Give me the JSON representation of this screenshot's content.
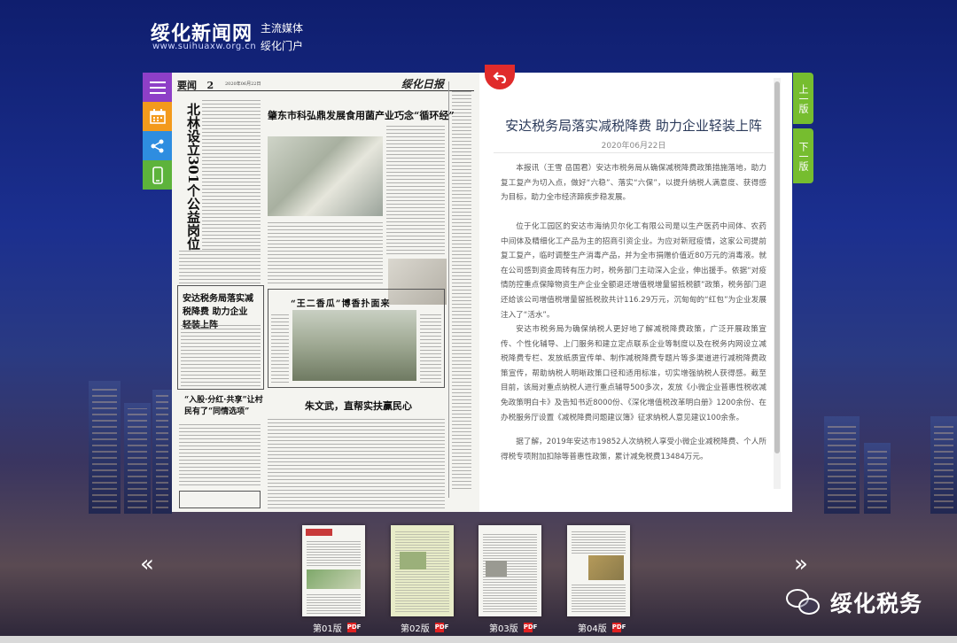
{
  "site": {
    "title": "绥化新闻网",
    "url": "www.suihuaxw.org.cn",
    "tagline_1": "主流媒体",
    "tagline_2": "绥化门户"
  },
  "sidebar_icons": [
    "menu-icon",
    "calendar-icon",
    "share-icon",
    "mobile-icon"
  ],
  "newspaper": {
    "page_label": "要闻",
    "page_number": "2",
    "masthead": "绥化日报",
    "headlines": {
      "vertical": "北林设立301个公益岗位",
      "top": "肇东市科弘鼎发展食用菌产业巧念“循环经”",
      "left_mid": "安达税务局落实减税降费 助力企业轻装上阵",
      "center_mid": "“王二香瓜”博香扑面来",
      "left_bottom": "“入股·分红·共享”让村民有了“同情选项”",
      "center_bottom": "朱文武，直帮实扶赢民心"
    }
  },
  "article": {
    "title": "安达税务局落实减税降费 助力企业轻装上阵",
    "date": "2020年06月22日",
    "paragraphs": [
      "本报讯（王雪 岳国君）安达市税务局从确保减税降费政策措施落地，助力复工复产为切入点，做好“六稳”、落实“六保”，以提升纳税人满意度、获得感为目标，助力全市经济蹄疾步稳发展。",
      "位于化工园区的安达市海纳贝尔化工有限公司是以生产医药中间体、农药中间体及精细化工产品为主的招商引资企业。为应对新冠疫情，这家公司提前复工复产，临时调整生产消毒产品，并为全市捐赠价值近80万元的消毒液。就在公司感到资金周转有压力时，税务部门主动深入企业，伸出援手。依据“对疫情防控重点保障物资生产企业全额退还增值税增量留抵税额”政策，税务部门退还给该公司增值税增量留抵税款共计116.29万元，沉甸甸的“红包”为企业发展注入了“活水”。",
      "安达市税务局为确保纳税人更好地了解减税降费政策，广泛开展政策宣传、个性化辅导、上门服务和建立定点联系企业等制度以及在税务内网设立减税降费专栏、发放纸质宣传单、制作减税降费专题片等多渠道进行减税降费政策宣传，帮助纳税人明晰政策口径和适用标准，切实增强纳税人获得感。截至目前，该局对重点纳税人进行重点辅导500多次，发放《小微企业普惠性税收减免政策明白卡》及告知书近8000份、《深化增值税改革明白册》1200余份、在办税服务厅设置《减税降费问题建议簿》征求纳税人意见建议100余条。",
      "据了解，2019年安达市19852人次纳税人享受小微企业减税降费、个人所得税专项附加扣除等普惠性政策，累计减免税费13484万元。"
    ]
  },
  "navigation": {
    "back_icon": "return-icon",
    "prev_edition": "上一版",
    "next_edition": "下一版",
    "prev_arrow": "«",
    "next_arrow": "»"
  },
  "thumbnails": [
    {
      "label": "第01版",
      "pdf": "PDF"
    },
    {
      "label": "第02版",
      "pdf": "PDF"
    },
    {
      "label": "第03版",
      "pdf": "PDF"
    },
    {
      "label": "第04版",
      "pdf": "PDF"
    }
  ],
  "watermark": {
    "icon": "wechat-icon",
    "text": "绥化税务"
  },
  "colors": {
    "menu": "#8e3fc7",
    "calendar": "#f39a1c",
    "share": "#2e8de0",
    "mobile": "#5db33b",
    "edition_nav": "#76bd2f",
    "back": "#e02b2b",
    "article_title": "#2b3a5a"
  }
}
